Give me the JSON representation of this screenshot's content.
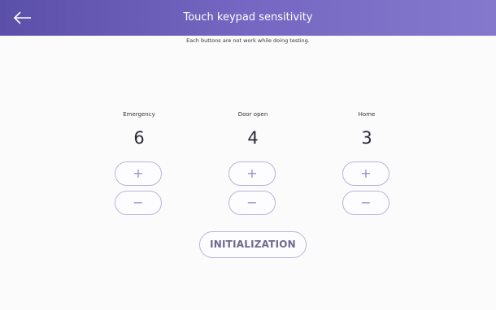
{
  "header": {
    "title": "Touch keypad sensitivity",
    "back_icon": "arrow-left-icon",
    "gradient_colors": [
      "#5a4fa9",
      "#8478cd"
    ]
  },
  "notice": "Each buttons are not work while doing testing.",
  "controls": [
    {
      "label": "Emergency",
      "value": "6",
      "plus": "+",
      "minus": "−"
    },
    {
      "label": "Door open",
      "value": "4",
      "plus": "+",
      "minus": "−"
    },
    {
      "label": "Home",
      "value": "3",
      "plus": "+",
      "minus": "−"
    }
  ],
  "initialization_label": "INITIALIZATION",
  "accent_color": "#b8b3de"
}
